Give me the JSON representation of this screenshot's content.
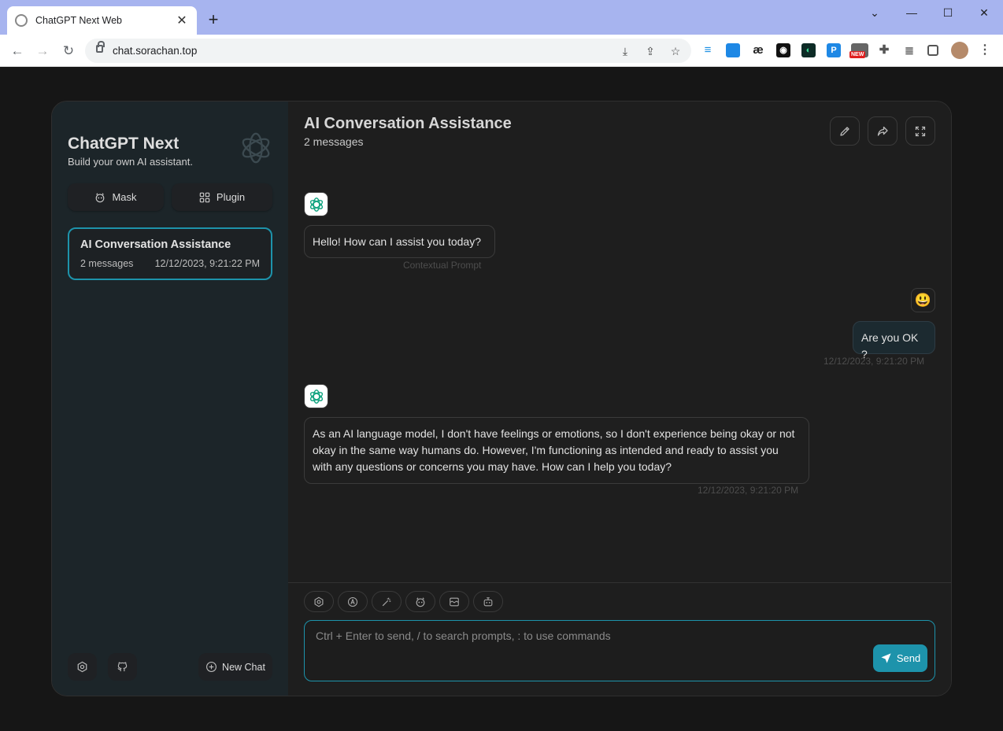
{
  "browser": {
    "tab_title": "ChatGPT Next Web",
    "tab_close": "✕",
    "new_tab": "+",
    "url": "chat.sorachan.top",
    "ext_new_badge": "NEW"
  },
  "sidebar": {
    "title": "ChatGPT Next",
    "subtitle": "Build your own AI assistant.",
    "mask_label": "Mask",
    "plugin_label": "Plugin",
    "chats": [
      {
        "title": "AI Conversation Assistance",
        "count": "2 messages",
        "date": "12/12/2023, 9:21:22 PM"
      }
    ],
    "new_chat_label": "New Chat"
  },
  "header": {
    "title": "AI Conversation Assistance",
    "subtitle": "2 messages"
  },
  "messages": [
    {
      "role": "assistant",
      "text": "Hello! How can I assist you today?",
      "meta": "Contextual Prompt"
    },
    {
      "role": "user",
      "avatar": "😃",
      "text": "Are you OK ?",
      "meta": "12/12/2023, 9:21:20 PM"
    },
    {
      "role": "assistant",
      "text": "As an AI language model, I don't have feelings or emotions, so I don't experience being okay or not okay in the same way humans do. However, I'm functioning as intended and ready to assist you with any questions or concerns you may have. How can I help you today?",
      "meta": "12/12/2023, 9:21:20 PM"
    }
  ],
  "composer": {
    "placeholder": "Ctrl + Enter to send, / to search prompts, : to use commands",
    "send_label": "Send"
  },
  "colors": {
    "accent": "#1d93ab",
    "sidebar_bg": "#1c2529",
    "main_bg": "#1e1e1e"
  }
}
